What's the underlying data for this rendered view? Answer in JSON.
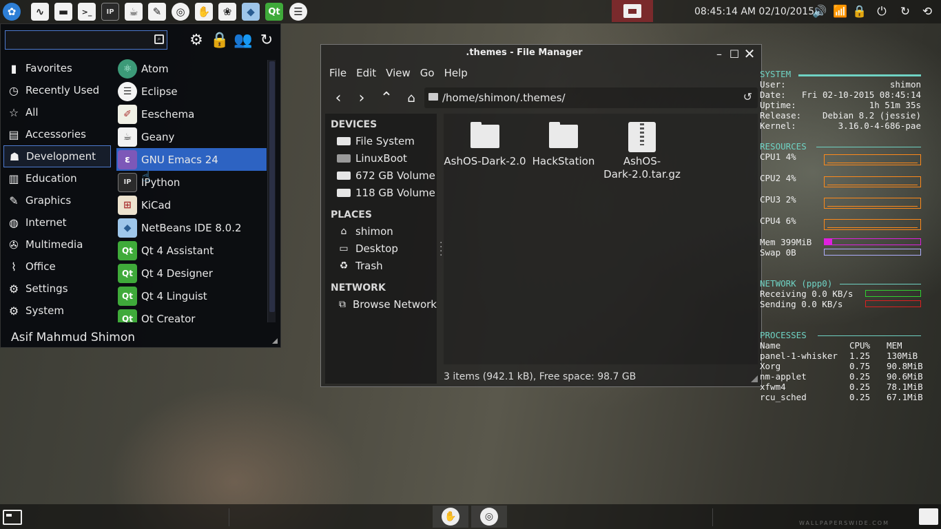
{
  "top_panel": {
    "launchers": [
      "whisker-menu-icon",
      "system-monitor-icon",
      "file-manager-icon",
      "terminal-icon",
      "ipython-icon",
      "geany-icon",
      "gimp-icon",
      "chromium-icon",
      "gnome-icon",
      "inkscape-icon",
      "netbeans-icon",
      "qt-icon",
      "eclipse-icon"
    ],
    "clock": "08:45:14 AM 02/10/2015",
    "tray": [
      "volume-icon",
      "network-icon",
      "lock-icon",
      "power-icon",
      "refresh-icon",
      "restart-icon"
    ]
  },
  "app_menu": {
    "search": {
      "value": "",
      "placeholder": ""
    },
    "header_icons": [
      "gear-icon",
      "lock-icon",
      "users-icon",
      "logout-icon"
    ],
    "categories": [
      {
        "label": "Favorites",
        "icon": "bookmark-icon"
      },
      {
        "label": "Recently Used",
        "icon": "clock-icon"
      },
      {
        "label": "All",
        "icon": "star-icon"
      },
      {
        "label": "Accessories",
        "icon": "accessories-icon"
      },
      {
        "label": "Development",
        "icon": "development-icon",
        "active": true
      },
      {
        "label": "Education",
        "icon": "education-icon"
      },
      {
        "label": "Graphics",
        "icon": "brush-icon"
      },
      {
        "label": "Internet",
        "icon": "globe-icon"
      },
      {
        "label": "Multimedia",
        "icon": "film-icon"
      },
      {
        "label": "Office",
        "icon": "paperclip-icon"
      },
      {
        "label": "Settings",
        "icon": "gear-icon"
      },
      {
        "label": "System",
        "icon": "system-gear-icon"
      }
    ],
    "apps": [
      {
        "label": "Atom",
        "icon": "atom-icon"
      },
      {
        "label": "Eclipse",
        "icon": "eclipse-icon"
      },
      {
        "label": "Eeschema",
        "icon": "eeschema-icon"
      },
      {
        "label": "Geany",
        "icon": "geany-icon"
      },
      {
        "label": "GNU Emacs 24",
        "icon": "emacs-icon",
        "active": true
      },
      {
        "label": "IPython",
        "icon": "ipython-icon"
      },
      {
        "label": "KiCad",
        "icon": "kicad-icon"
      },
      {
        "label": "NetBeans IDE 8.0.2",
        "icon": "netbeans-icon"
      },
      {
        "label": "Qt 4 Assistant",
        "icon": "qt-assistant-icon"
      },
      {
        "label": "Qt 4 Designer",
        "icon": "qt-designer-icon"
      },
      {
        "label": "Qt 4 Linguist",
        "icon": "qt-linguist-icon"
      },
      {
        "label": "Qt Creator",
        "icon": "qt-creator-icon"
      }
    ],
    "user_name": "Asif Mahmud Shimon"
  },
  "file_manager": {
    "title": ".themes - File Manager",
    "menu": [
      "File",
      "Edit",
      "View",
      "Go",
      "Help"
    ],
    "path": "/home/shimon/.themes/",
    "sidebar": {
      "devices_header": "DEVICES",
      "devices": [
        "File System",
        "LinuxBoot",
        "672 GB Volume",
        "118 GB Volume"
      ],
      "places_header": "PLACES",
      "places": [
        "shimon",
        "Desktop",
        "Trash"
      ],
      "network_header": "NETWORK",
      "network": [
        "Browse Network"
      ]
    },
    "files": [
      {
        "name": "AshOS-Dark-2.0",
        "type": "folder"
      },
      {
        "name": "HackStation",
        "type": "folder"
      },
      {
        "name": "AshOS-Dark-2.0.tar.gz",
        "type": "archive"
      }
    ],
    "file3_line1": "AshOS-",
    "file3_line2": "Dark-2.0.tar.gz",
    "status": "3 items (942.1 kB), Free space: 98.7 GB"
  },
  "conky": {
    "system_header": "SYSTEM",
    "user_label": "User:",
    "user_value": "shimon",
    "date_label": "Date:",
    "date_value": "Fri 02-10-2015 08:45:14",
    "uptime_label": "Uptime:",
    "uptime_value": "1h 51m 35s",
    "release_label": "Release:",
    "release_value": "Debian 8.2 (jessie)",
    "kernel_label": "Kernel:",
    "kernel_value": "3.16.0-4-686-pae",
    "resources_header": "RESOURCES",
    "cpu1": "CPU1 4%",
    "cpu2": "CPU2 4%",
    "cpu3": "CPU3 2%",
    "cpu4": "CPU4 6%",
    "mem": "Mem 399MiB",
    "mem_fraction": 0.08,
    "swap": "Swap 0B",
    "swap_fraction": 0.0,
    "network_header": "NETWORK (ppp0)",
    "receiving": "Receiving 0.0 KB/s",
    "sending": "Sending   0.0 KB/s",
    "processes_header": "PROCESSES",
    "proc_columns": [
      "Name",
      "CPU%",
      "MEM"
    ],
    "processes": [
      {
        "name": "panel-1-whisker",
        "cpu": "1.25",
        "mem": "130MiB"
      },
      {
        "name": "Xorg",
        "cpu": "0.75",
        "mem": "90.8MiB"
      },
      {
        "name": "nm-applet",
        "cpu": "0.25",
        "mem": "90.6MiB"
      },
      {
        "name": "xfwm4",
        "cpu": "0.25",
        "mem": "78.1MiB"
      },
      {
        "name": "rcu_sched",
        "cpu": "0.25",
        "mem": "67.1MiB"
      }
    ],
    "colors": {
      "accent": "#6fd3c4",
      "cpu_graph": "#ff8a1a",
      "mem_bar": "#e020e0",
      "swap_bar": "#b0b0ff",
      "recv": "#30d030",
      "send": "#e02020"
    }
  },
  "bottom_panel": {
    "tasks": [
      "gimp-task-icon",
      "chromium-task-icon"
    ],
    "watermark": "WALLPAPERSWIDE.COM"
  }
}
